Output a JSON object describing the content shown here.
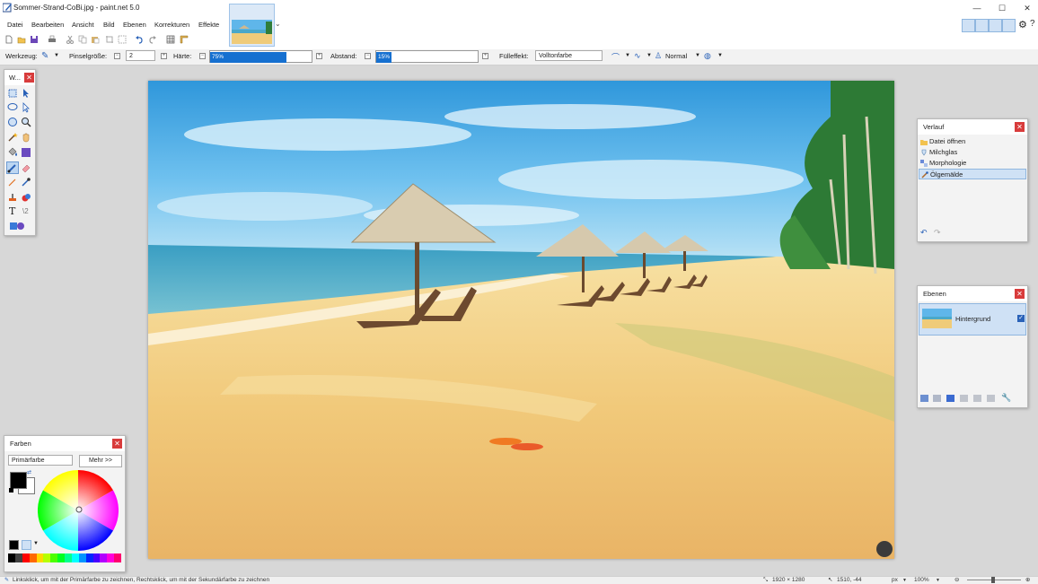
{
  "window": {
    "title": "Sommer-Strand-CoBi.jpg - paint.net 5.0",
    "controls": {
      "minimize": "—",
      "maximize": "☐",
      "close": "✕"
    }
  },
  "menu": {
    "items": [
      "Datei",
      "Bearbeiten",
      "Ansicht",
      "Bild",
      "Ebenen",
      "Korrekturen",
      "Effekte"
    ]
  },
  "toolbar": {
    "icons": [
      "new-icon",
      "open-icon",
      "save-icon",
      "print-icon",
      "cut-icon",
      "copy-icon",
      "paste-icon",
      "crop-icon",
      "deselect-icon",
      "undo-icon",
      "redo-icon",
      "grid-icon",
      "ruler-icon"
    ]
  },
  "tool_options": {
    "tool_label": "Werkzeug:",
    "brush_size_label": "Pinselgröße:",
    "brush_size_value": "2",
    "hardness_label": "Härte:",
    "hardness_value": "75%",
    "hardness_fraction": 0.75,
    "spacing_label": "Abstand:",
    "spacing_value": "15%",
    "spacing_fraction": 0.15,
    "fill_label": "Fülleffekt:",
    "fill_value": "Volltonfarbe",
    "blend_mode": "Normal"
  },
  "tools_panel": {
    "title": "W..."
  },
  "history_panel": {
    "title": "Verlauf",
    "items": [
      "Datei öffnen",
      "Milchglas",
      "Morphologie",
      "Ölgemälde"
    ],
    "selected_index": 3
  },
  "layers_panel": {
    "title": "Ebenen",
    "layers": [
      {
        "name": "Hintergrund",
        "visible": true
      }
    ]
  },
  "colors_panel": {
    "title": "Farben",
    "mode": "Primärfarbe",
    "more_button": "Mehr >>",
    "primary_color": "#000000",
    "secondary_color": "#ffffff"
  },
  "status": {
    "hint": "Linksklick, um mit der Primärfarbe zu zeichnen, Rechtsklick, um mit der Sekundärfarbe zu zeichnen",
    "image_size": "1920 × 1280",
    "cursor_pos": "1510, -44",
    "unit": "px",
    "zoom": "100%"
  },
  "colors": {
    "accent": "#1670d0",
    "selection": "#cfe1f5",
    "close_red": "#d83b3b"
  }
}
